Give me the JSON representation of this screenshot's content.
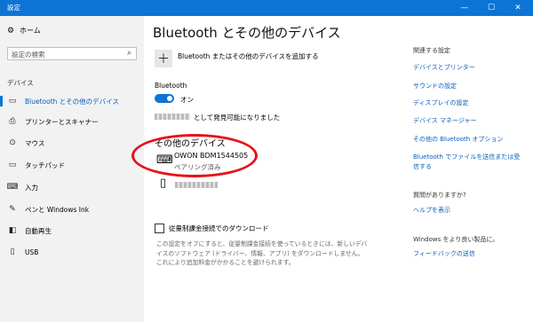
{
  "window": {
    "title": "設定",
    "minimize": "—",
    "maximize": "☐",
    "close": "✕"
  },
  "sidebar": {
    "home": "ホーム",
    "search_placeholder": "設定の検索",
    "section": "デバイス",
    "items": [
      {
        "label": "Bluetooth とその他のデバイス",
        "icon": "bluetooth-icon"
      },
      {
        "label": "プリンターとスキャナー",
        "icon": "printer-icon"
      },
      {
        "label": "マウス",
        "icon": "mouse-icon"
      },
      {
        "label": "タッチパッド",
        "icon": "touchpad-icon"
      },
      {
        "label": "入力",
        "icon": "keyboard-icon"
      },
      {
        "label": "ペンと Windows Ink",
        "icon": "pen-icon"
      },
      {
        "label": "自動再生",
        "icon": "autoplay-icon"
      },
      {
        "label": "USB",
        "icon": "usb-icon"
      }
    ]
  },
  "main": {
    "title": "Bluetooth とその他のデバイス",
    "add_device": "Bluetooth またはその他のデバイスを追加する",
    "bluetooth_label": "Bluetooth",
    "toggle_state": "オン",
    "discoverable_text": "として発見可能になりました",
    "other_devices_heading": "その他のデバイス",
    "device_name": "OWON BDM1544505",
    "device_status": "ペアリング済み",
    "metered_label": "従量制課金接続でのダウンロード",
    "metered_desc": "この設定をオフにすると、従量制課金接続を使っているときには、新しいデバイスのソフトウェア (ドライバー、情報、アプリ) をダウンロードしません。これにより追加料金がかかることを避けられます。"
  },
  "right": {
    "related_heading": "関連する設定",
    "links": [
      "デバイスとプリンター",
      "サウンドの設定",
      "ディスプレイの設定",
      "デバイス マネージャー",
      "その他の Bluetooth オプション",
      "Bluetooth でファイルを送信または受信する"
    ],
    "question_heading": "質問がありますか?",
    "help_link": "ヘルプを表示",
    "improve_heading": "Windows をより良い製品に。",
    "feedback_link": "フィードバックの送信"
  },
  "colors": {
    "accent": "#0c74d4",
    "highlight_circle": "#e8101a"
  }
}
